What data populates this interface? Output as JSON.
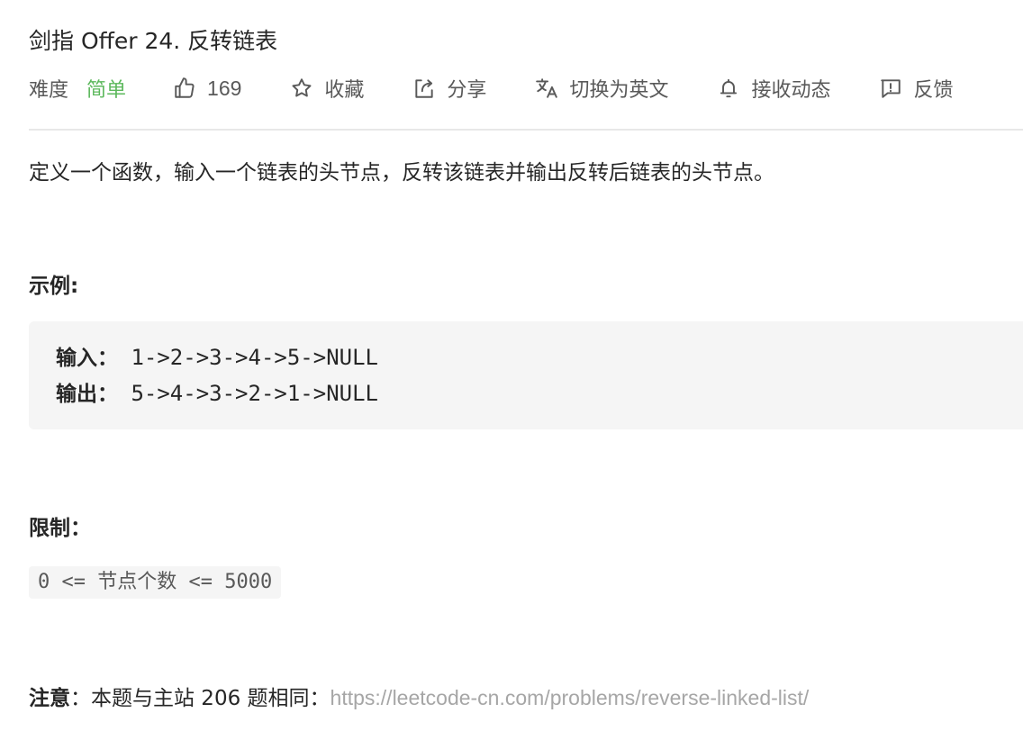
{
  "problem": {
    "title": "剑指 Offer 24. 反转链表"
  },
  "meta": {
    "difficulty_label": "难度",
    "difficulty_value": "简单",
    "like_count": "169",
    "favorite_label": "收藏",
    "share_label": "分享",
    "switch_language_label": "切换为英文",
    "subscribe_label": "接收动态",
    "feedback_label": "反馈"
  },
  "description": "定义一个函数，输入一个链表的头节点，反转该链表并输出反转后链表的头节点。",
  "example": {
    "heading": "示例:",
    "input_label": "输入：",
    "input_value": " 1->2->3->4->5->NULL",
    "output_label": "输出：",
    "output_value": " 5->4->3->2->1->NULL"
  },
  "limits": {
    "heading": "限制：",
    "constraint": "0 <= 节点个数 <= 5000"
  },
  "note": {
    "label": "注意",
    "text": "：本题与主站 206 题相同：",
    "link": "https://leetcode-cn.com/problems/reverse-linked-list/"
  },
  "colors": {
    "difficulty_easy": "#5cb85c",
    "link": "#a6a6a6"
  }
}
